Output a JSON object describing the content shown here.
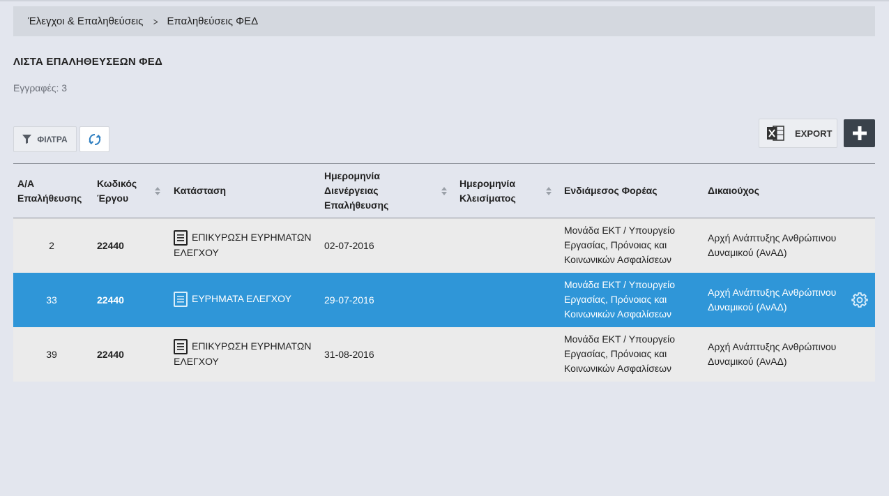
{
  "breadcrumb": {
    "parent": "Έλεγχοι & Επαληθεύσεις",
    "separator": ">",
    "current": "Επαληθεύσεις ΦΕΔ"
  },
  "page": {
    "title": "ΛΙΣΤΑ ΕΠΑΛΗΘΕΥΣΕΩΝ ΦΕΔ",
    "records": "Εγγραφές: 3"
  },
  "toolbar": {
    "filter_label": "ΦΙΛΤΡΑ",
    "export_label": "EXPORT"
  },
  "table": {
    "headers": {
      "aa_line1": "Α/Α",
      "aa_line2": "Επαλήθευσης",
      "code_line1": "Κωδικός",
      "code_line2": "Έργου",
      "status": "Κατάσταση",
      "date_line1": "Ημερομηνία",
      "date_line2": "Διενέργειας",
      "date_line3": "Επαλήθευσης",
      "close_line1": "Ημερομηνία",
      "close_line2": "Κλεισίματος",
      "body": "Ενδιάμεσος Φορέας",
      "beneficiary": "Δικαιούχος"
    },
    "rows": [
      {
        "aa": "2",
        "code": "22440",
        "status_line1": "ΕΠΙΚΥΡΩΣΗ ΕΥΡΗΜΑΤΩΝ",
        "status_line2": "ΕΛΕΓΧΟΥ",
        "date": "02-07-2016",
        "close_date": "",
        "body_line1": "Μονάδα ΕΚΤ / Υπουργείο",
        "body_line2": "Εργασίας, Πρόνοιας και",
        "body_line3": "Κοινωνικών Ασφαλίσεων",
        "ben_line1": "Αρχή Ανάπτυξης Ανθρώπινου",
        "ben_line2": "Δυναμικού (ΑνΑΔ)"
      },
      {
        "aa": "33",
        "code": "22440",
        "status_line1": "ΕΥΡΗΜΑΤΑ ΕΛΕΓΧΟΥ",
        "status_line2": "",
        "date": "29-07-2016",
        "close_date": "",
        "body_line1": "Μονάδα ΕΚΤ / Υπουργείο",
        "body_line2": "Εργασίας, Πρόνοιας και",
        "body_line3": "Κοινωνικών Ασφαλίσεων",
        "ben_line1": "Αρχή Ανάπτυξης Ανθρώπινου",
        "ben_line2": "Δυναμικού (ΑνΑΔ)"
      },
      {
        "aa": "39",
        "code": "22440",
        "status_line1": "ΕΠΙΚΥΡΩΣΗ ΕΥΡΗΜΑΤΩΝ",
        "status_line2": "ΕΛΕΓΧΟΥ",
        "date": "31-08-2016",
        "close_date": "",
        "body_line1": "Μονάδα ΕΚΤ / Υπουργείο",
        "body_line2": "Εργασίας, Πρόνοιας και",
        "body_line3": "Κοινωνικών Ασφαλίσεων",
        "ben_line1": "Αρχή Ανάπτυξης Ανθρώπινου",
        "ben_line2": "Δυναμικού (ΑνΑΔ)"
      }
    ]
  },
  "colors": {
    "background": "#e3e6ee",
    "selected_row": "#2f96d8",
    "row": "#ebebeb",
    "add_button": "#3a424b"
  },
  "icons": [
    "chevron-right-icon",
    "filter-icon",
    "refresh-icon",
    "excel-icon",
    "plus-icon",
    "document-icon",
    "gear-icon",
    "sort-icon"
  ]
}
